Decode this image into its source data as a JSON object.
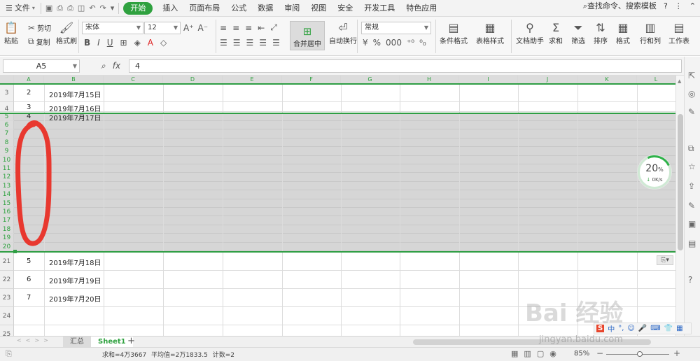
{
  "menubar": {
    "file": "文件",
    "items": [
      "开始",
      "插入",
      "页面布局",
      "公式",
      "数据",
      "审阅",
      "视图",
      "安全",
      "开发工具",
      "特色应用"
    ],
    "search": "查找命令、搜索模板"
  },
  "ribbon": {
    "paste": "粘贴",
    "cut": "剪切",
    "copy": "复制",
    "format_painter": "格式刷",
    "font_name": "宋体",
    "font_size": "12",
    "merge_center": "合并居中",
    "wrap_text": "自动换行",
    "number_format": "常规",
    "conditional_format": "条件格式",
    "table_style": "表格样式",
    "doc_helper": "文档助手",
    "sum": "求和",
    "filter": "筛选",
    "sort": "排序",
    "format": "格式",
    "rows_cols": "行和列",
    "worksheet": "工作表"
  },
  "formula_bar": {
    "cell_ref": "A5",
    "fx": "fx",
    "value": "4"
  },
  "columns": [
    "A",
    "B",
    "C",
    "D",
    "E",
    "F",
    "G",
    "H",
    "I",
    "J",
    "K",
    "L"
  ],
  "rows_top": [
    {
      "num": "3",
      "a": "2",
      "b": "2019年7月15日"
    },
    {
      "num": "4",
      "a": "3",
      "b": "2019年7月16日"
    },
    {
      "num": "5",
      "a": "4",
      "b": "2019年7月17日"
    }
  ],
  "rows_selected": [
    "6",
    "7",
    "8",
    "9",
    "10",
    "11",
    "12",
    "13",
    "14",
    "15",
    "16",
    "17",
    "18",
    "19",
    "20"
  ],
  "rows_bottom": [
    {
      "num": "21",
      "a": "5",
      "b": "2019年7月18日"
    },
    {
      "num": "22",
      "a": "6",
      "b": "2019年7月19日"
    },
    {
      "num": "23",
      "a": "7",
      "b": "2019年7月20日"
    },
    {
      "num": "24",
      "a": "",
      "b": ""
    },
    {
      "num": "25",
      "a": "",
      "b": ""
    }
  ],
  "widget": {
    "percent": "20",
    "percent_unit": "%",
    "rate": "0K/s"
  },
  "sheets": [
    "汇总",
    "Sheet1"
  ],
  "status": {
    "sum": "求和=4万3667",
    "avg": "平均值=2万1833.5",
    "count": "计数=2",
    "zoom": "85%"
  },
  "ime": {
    "logo": "S",
    "lang": "中"
  },
  "watermark": {
    "text": "Bai 经验",
    "url": "jingyan.baidu.com"
  },
  "colors": {
    "accent": "#2fa13f",
    "selection_border": "#2f9e44",
    "annotation": "#e8382f"
  }
}
